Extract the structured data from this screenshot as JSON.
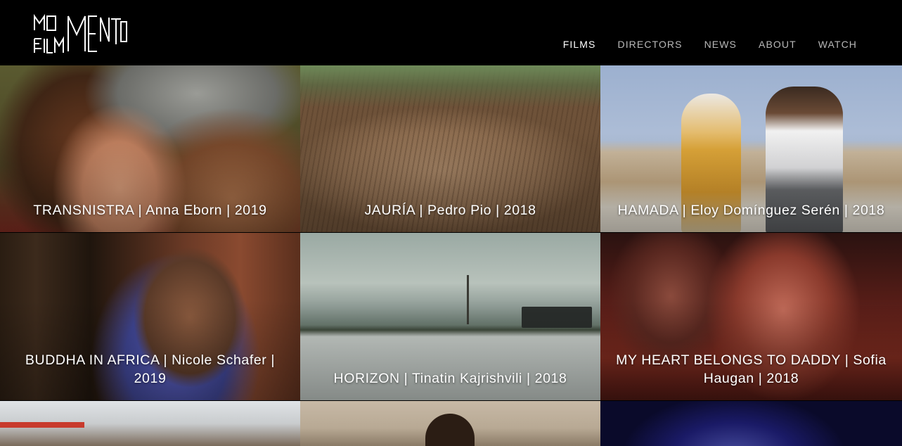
{
  "brand": {
    "logo_text": "MOMENTO FILM"
  },
  "nav": {
    "items": [
      {
        "label": "FILMS",
        "active": true
      },
      {
        "label": "DIRECTORS",
        "active": false
      },
      {
        "label": "NEWS",
        "active": false
      },
      {
        "label": "ABOUT",
        "active": false
      },
      {
        "label": "WATCH",
        "active": false
      }
    ]
  },
  "films": [
    {
      "caption": "TRANSNISTRA | Anna Eborn | 2019"
    },
    {
      "caption": "JAURÍA | Pedro Pio | 2018"
    },
    {
      "caption": "HAMADA | Eloy Domínguez Serén | 2018"
    },
    {
      "caption": "BUDDHA IN AFRICA | Nicole Schafer | 2019"
    },
    {
      "caption": "HORIZON | Tinatin Kajrishvili | 2018"
    },
    {
      "caption": "MY HEART BELONGS TO DADDY | Sofia Haugan | 2018"
    },
    {
      "caption": ""
    },
    {
      "caption": ""
    },
    {
      "caption": ""
    }
  ],
  "colors": {
    "background": "#000000",
    "nav_active": "#ffffff",
    "nav_inactive": "#b9b9b9"
  }
}
